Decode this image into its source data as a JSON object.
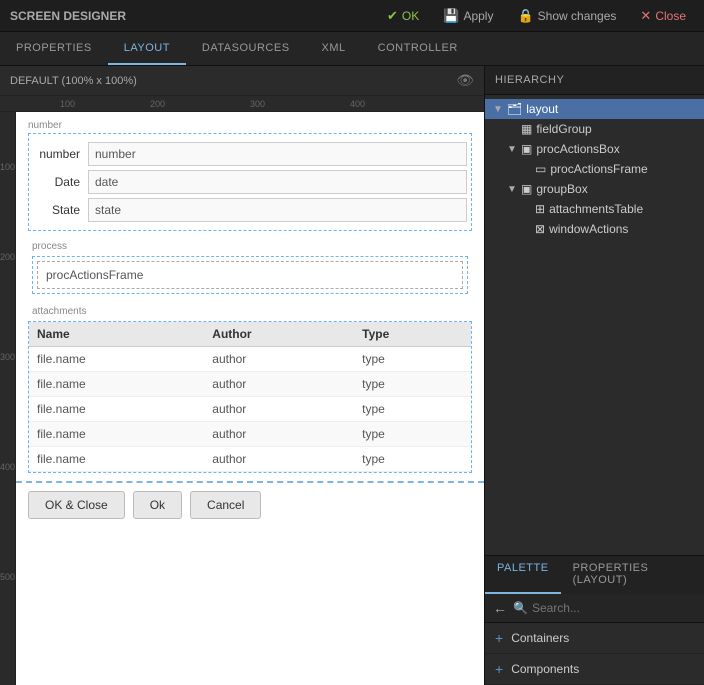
{
  "topbar": {
    "title": "SCREEN DESIGNER",
    "ok_label": "OK",
    "apply_label": "Apply",
    "show_changes_label": "Show changes",
    "close_label": "Close"
  },
  "navtabs": {
    "tabs": [
      "PROPERTIES",
      "LAYOUT",
      "DATASOURCES",
      "XML",
      "CONTROLLER"
    ],
    "active": "LAYOUT"
  },
  "canvas": {
    "default_label": "DEFAULT (100% x 100%)",
    "ruler_h": [
      "100",
      "200",
      "300",
      "400"
    ],
    "ruler_v": [
      "100",
      "200",
      "300",
      "400",
      "500"
    ]
  },
  "form": {
    "fieldgroup_label": "number",
    "fields": [
      {
        "label": "number",
        "value": "number"
      },
      {
        "label": "Date",
        "value": "date"
      },
      {
        "label": "State",
        "value": "state"
      }
    ],
    "process_label": "process",
    "proc_frame_label": "procActionsFrame",
    "attachments_label": "attachments",
    "table_headers": [
      "Name",
      "Author",
      "Type"
    ],
    "table_rows": [
      [
        "file.name",
        "author",
        "type"
      ],
      [
        "file.name",
        "author",
        "type"
      ],
      [
        "file.name",
        "author",
        "type"
      ],
      [
        "file.name",
        "author",
        "type"
      ],
      [
        "file.name",
        "author",
        "type"
      ]
    ]
  },
  "bottom_buttons": [
    {
      "label": "OK & Close"
    },
    {
      "label": "Ok"
    },
    {
      "label": "Cancel"
    }
  ],
  "hierarchy": {
    "title": "HIERARCHY",
    "items": [
      {
        "label": "layout",
        "indent": 0,
        "has_arrow": true,
        "selected": true,
        "icon": "🗂"
      },
      {
        "label": "fieldGroup",
        "indent": 1,
        "has_arrow": false,
        "selected": false,
        "icon": "⊞"
      },
      {
        "label": "procActionsBox",
        "indent": 1,
        "has_arrow": true,
        "selected": false,
        "icon": "⊟"
      },
      {
        "label": "procActionsFrame",
        "indent": 2,
        "has_arrow": false,
        "selected": false,
        "icon": "▭"
      },
      {
        "label": "groupBox",
        "indent": 1,
        "has_arrow": true,
        "selected": false,
        "icon": "⊟"
      },
      {
        "label": "attachmentsTable",
        "indent": 2,
        "has_arrow": false,
        "selected": false,
        "icon": "⊞"
      },
      {
        "label": "windowActions",
        "indent": 2,
        "has_arrow": false,
        "selected": false,
        "icon": "⊠"
      }
    ]
  },
  "palette": {
    "tabs": [
      "PALETTE",
      "PROPERTIES (layout)"
    ],
    "active_tab": "PALETTE",
    "search_placeholder": "Search...",
    "back_icon": "←",
    "items": [
      {
        "label": "Containers"
      },
      {
        "label": "Components"
      }
    ]
  }
}
